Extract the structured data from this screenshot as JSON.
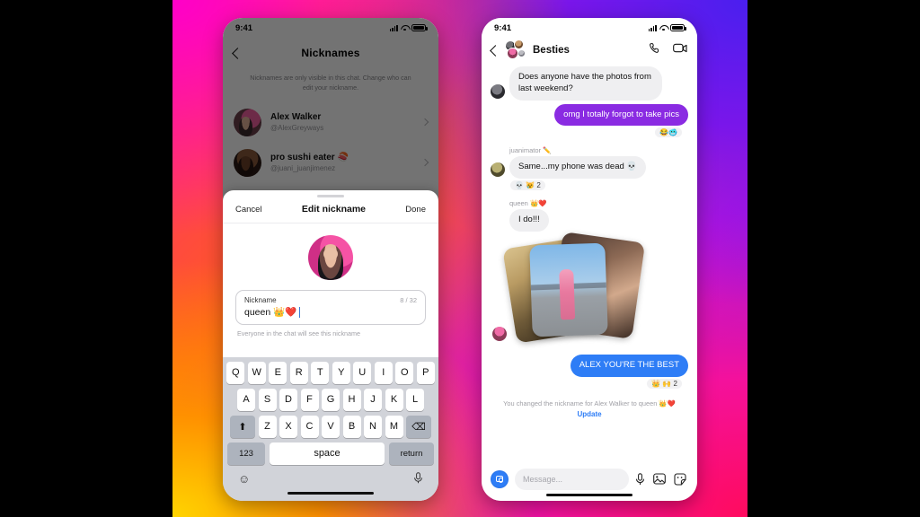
{
  "background": {
    "gradient_colors": [
      "#ff00c8",
      "#ff2f55",
      "#ff8c00",
      "#ffd400",
      "#f4119c",
      "#8c1ae8",
      "#4a1fef"
    ],
    "letterbox_color": "#000000"
  },
  "left_phone": {
    "status": {
      "time": "9:41",
      "signal_icon": "cellular-signal-icon",
      "wifi_icon": "wifi-icon",
      "battery_icon": "battery-icon"
    },
    "nicknames_screen": {
      "back_icon": "back-chevron-icon",
      "title": "Nicknames",
      "description": "Nicknames are only visible in this chat. Change who can edit your nickname.",
      "rows": [
        {
          "name": "Alex Walker",
          "handle": "@AlexGreyways",
          "chevron_icon": "chevron-right-icon"
        },
        {
          "name": "pro sushi eater 🍣",
          "handle": "@juani_juanjimenez",
          "chevron_icon": "chevron-right-icon"
        }
      ]
    },
    "sheet": {
      "cancel_label": "Cancel",
      "title": "Edit nickname",
      "done_label": "Done",
      "avatar_name": "avatar",
      "field": {
        "label": "Nickname",
        "value": "queen 👑❤️",
        "counter": "8 / 32",
        "help": "Everyone in the chat will see this nickname"
      }
    },
    "keyboard": {
      "row1": [
        "Q",
        "W",
        "E",
        "R",
        "T",
        "Y",
        "U",
        "I",
        "O",
        "P"
      ],
      "row2": [
        "A",
        "S",
        "D",
        "F",
        "G",
        "H",
        "J",
        "K",
        "L"
      ],
      "row3": [
        "Z",
        "X",
        "C",
        "V",
        "B",
        "N",
        "M"
      ],
      "shift_icon": "⬆",
      "backspace_icon": "⌫",
      "numbers_label": "123",
      "space_label": "space",
      "return_label": "return",
      "emoji_icon": "☺",
      "mic_icon": "mic-icon"
    }
  },
  "right_phone": {
    "status": {
      "time": "9:41",
      "signal_icon": "cellular-signal-icon",
      "wifi_icon": "wifi-icon",
      "battery_icon": "battery-icon"
    },
    "header": {
      "back_icon": "back-chevron-icon",
      "group_avatar": "group-avatar",
      "title": "Besties",
      "call_icon": "phone-call-icon",
      "video_icon": "video-call-icon"
    },
    "messages": [
      {
        "type": "incoming",
        "text": "Does anyone have the photos from last weekend?",
        "sender": "",
        "reactions": ""
      },
      {
        "type": "outgoing",
        "text": "omg I totally forgot to take pics",
        "sender": "",
        "reactions": "😂🥶",
        "color": "#8a2be2"
      },
      {
        "type": "incoming",
        "text": "Same...my phone was dead 💀",
        "sender": "juanimator ✏️",
        "reactions": "💀 😿 2"
      },
      {
        "type": "incoming",
        "text": "I do!!!",
        "sender": "queen 👑❤️",
        "reactions": ""
      },
      {
        "type": "photos",
        "text": "",
        "sender": "",
        "reactions": "",
        "count": 3
      },
      {
        "type": "outgoing",
        "text": "ALEX YOU'RE THE BEST",
        "sender": "",
        "reactions": "👑 🙌 2",
        "color": "#2e7df6"
      }
    ],
    "system": {
      "text": "You changed the nickname for Alex Walker to queen 👑❤️",
      "link_label": "Update"
    },
    "composer": {
      "camera_icon": "camera-icon",
      "placeholder": "Message...",
      "mic_icon": "mic-icon",
      "gallery_icon": "image-icon",
      "sticker_icon": "sticker-icon"
    }
  }
}
